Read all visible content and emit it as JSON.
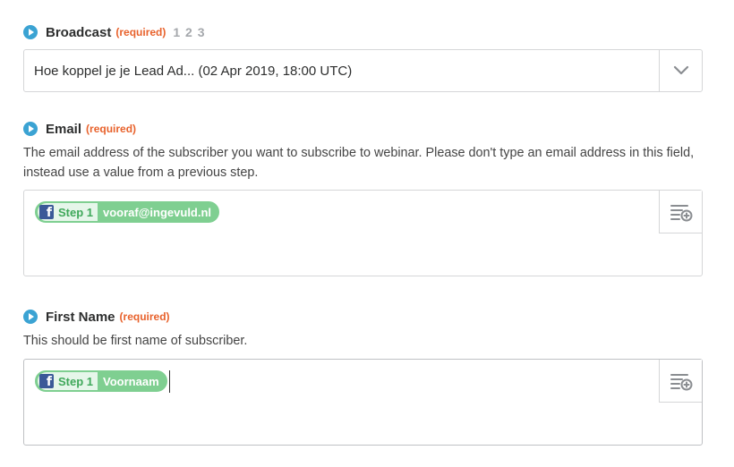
{
  "broadcast": {
    "label": "Broadcast",
    "required": "(required)",
    "steps": "1 2 3",
    "value": "Hoe koppel je je Lead Ad... (02 Apr 2019, 18:00 UTC)"
  },
  "email": {
    "label": "Email",
    "required": "(required)",
    "help": "The email address of the subscriber you want to subscribe to webinar. Please don't type an email address in this field, instead use a value from a previous step.",
    "pill": {
      "step": "Step 1",
      "value": "vooraf@ingevuld.nl",
      "icon": "facebook-icon"
    }
  },
  "first_name": {
    "label": "First Name",
    "required": "(required)",
    "help": "This should be first name of subscriber.",
    "pill": {
      "step": "Step 1",
      "value": "Voornaam",
      "icon": "facebook-icon"
    }
  },
  "colors": {
    "accent": "#3ba3d3",
    "required": "#e8622c",
    "pill": "#7fcf91",
    "facebook": "#3b5998"
  }
}
